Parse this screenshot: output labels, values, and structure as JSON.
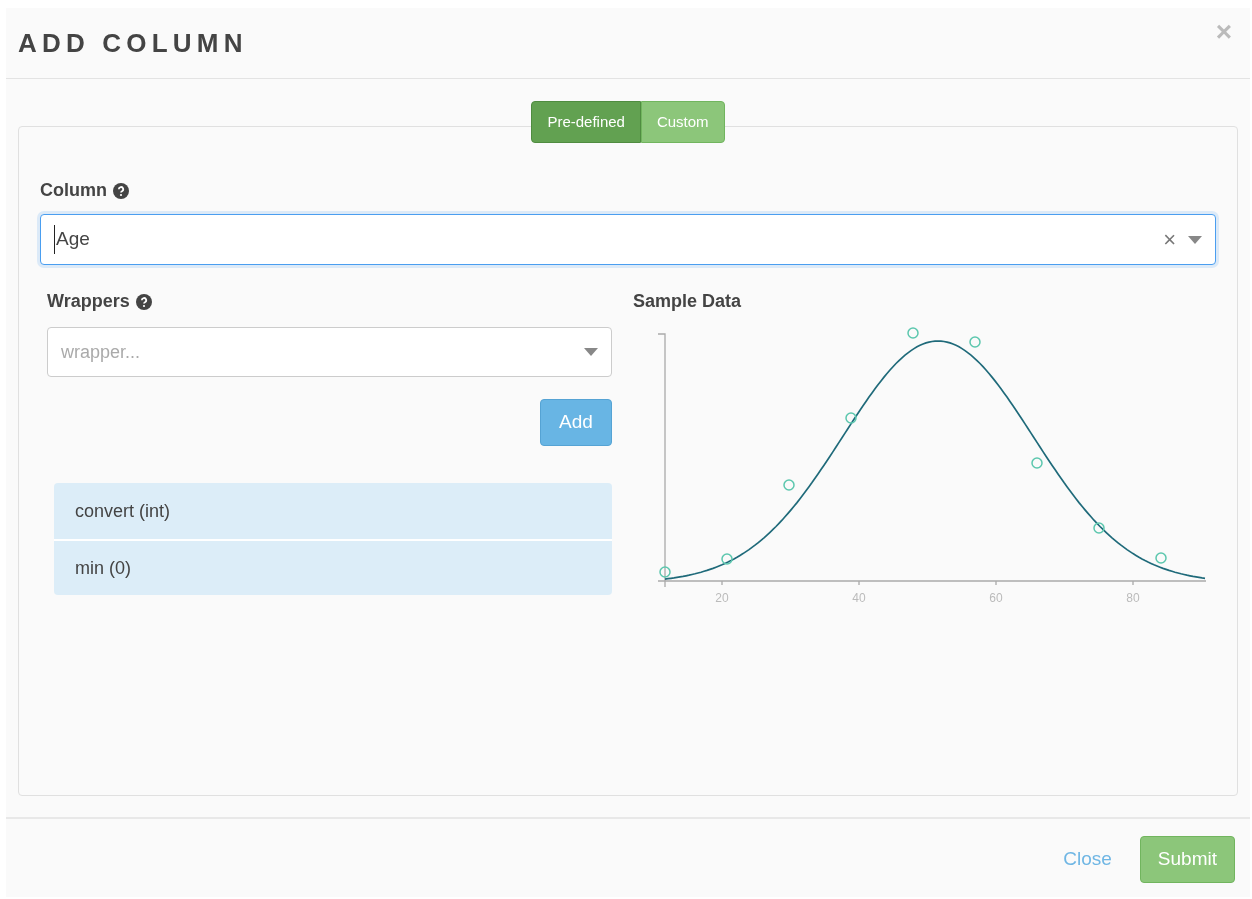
{
  "dialog": {
    "title": "ADD COLUMN",
    "close_glyph": "×"
  },
  "mode_toggle": [
    {
      "label": "Pre-defined",
      "selected": true
    },
    {
      "label": "Custom",
      "selected": false
    }
  ],
  "column_field": {
    "label": "Column",
    "value": "Age",
    "clear_glyph": "×"
  },
  "wrappers": {
    "label": "Wrappers",
    "placeholder": "wrapper...",
    "add_button": "Add",
    "items": [
      "convert (int)",
      "min (0)"
    ]
  },
  "sample_data": {
    "title": "Sample Data",
    "x_tick_labels": [
      "20",
      "40",
      "60",
      "80"
    ]
  },
  "footer": {
    "close": "Close",
    "submit": "Submit"
  }
}
